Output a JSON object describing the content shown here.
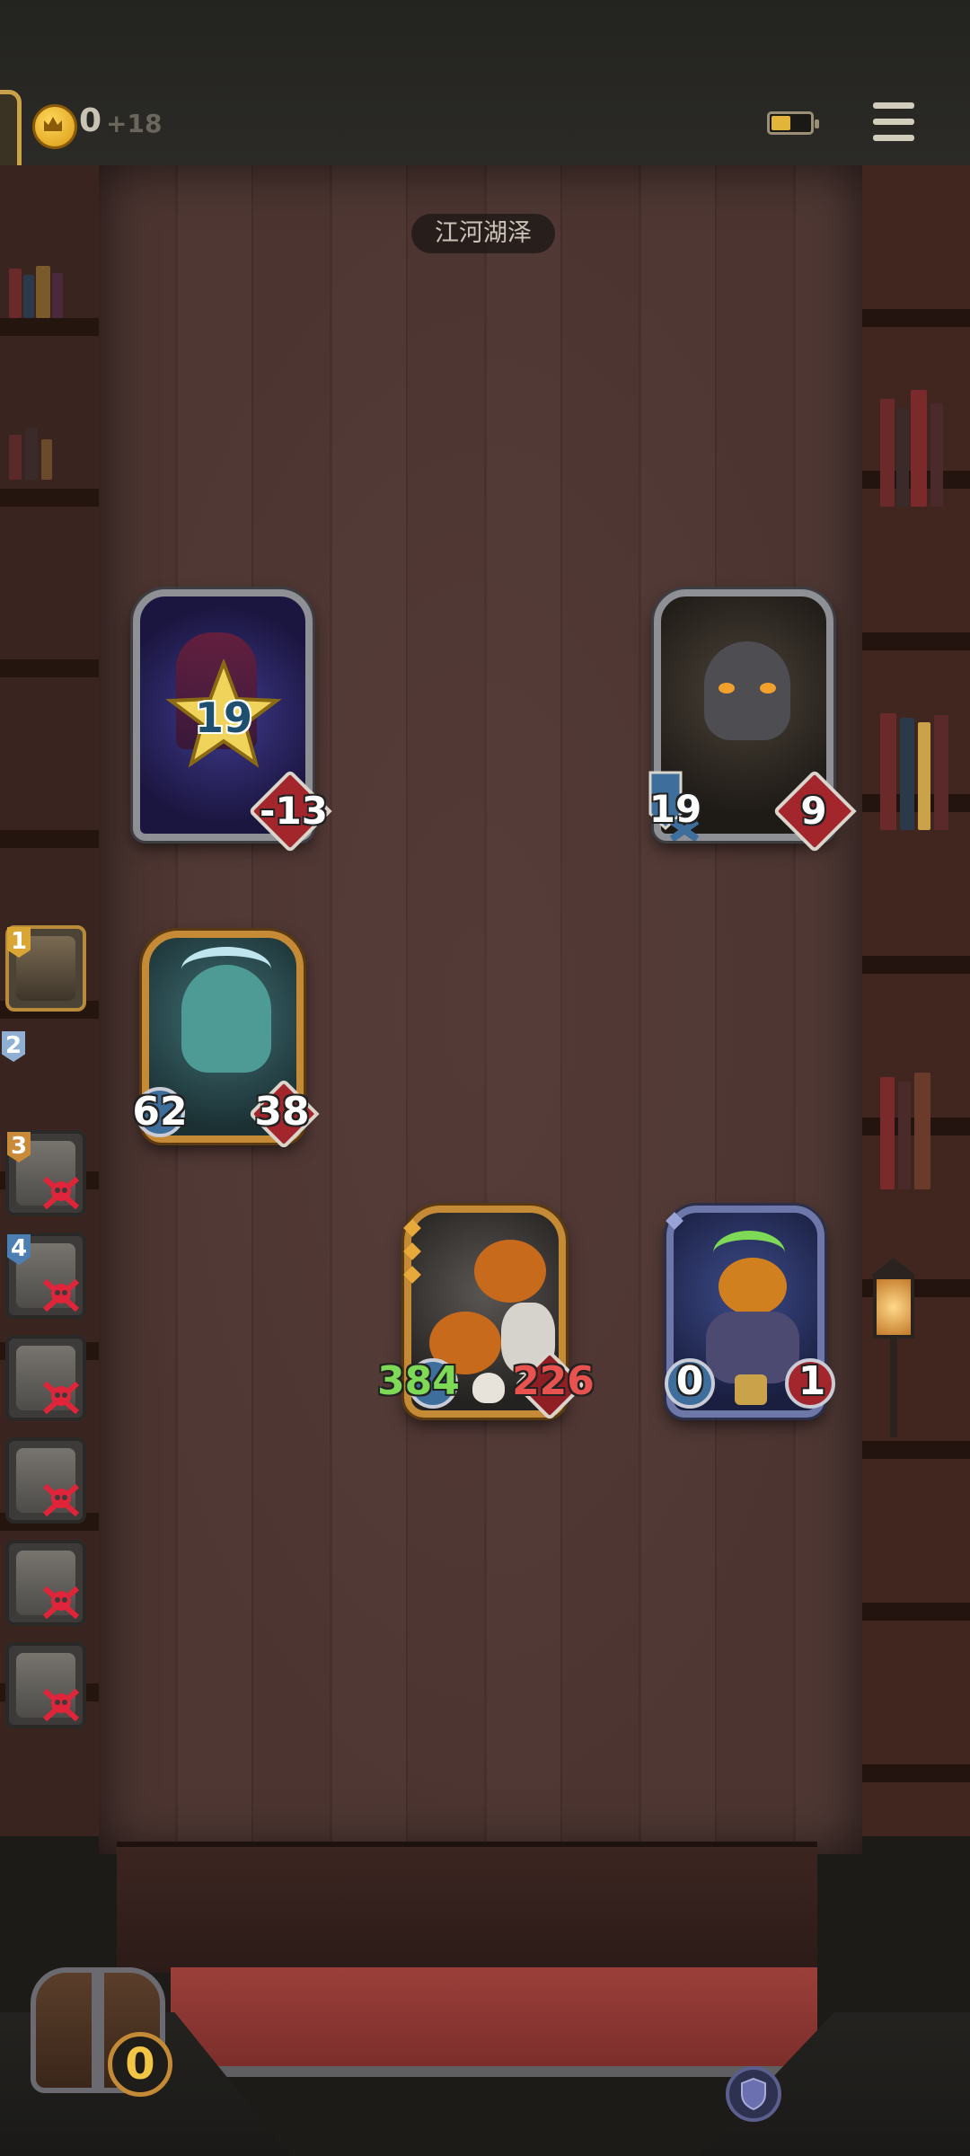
{
  "header": {
    "gold_amount": "0",
    "gold_delta": "+18",
    "battery_level_fraction": 0.5
  },
  "area_label": "江河湖泽",
  "enemy_row": [
    {
      "name": "star-ward",
      "star_value": "19",
      "health": "-13"
    },
    {
      "name": "gray-cat",
      "attack": "19",
      "health": "9"
    }
  ],
  "player_units": [
    {
      "name": "ghost-skeleton",
      "attack": "62",
      "health": "38"
    },
    {
      "name": "pumpkin-horde",
      "attack": "384",
      "health": "226"
    },
    {
      "name": "pumpkin-golem",
      "attack": "0",
      "health": "1"
    }
  ],
  "queue": [
    {
      "badge": "1",
      "defeated": false
    },
    {
      "badge": "2",
      "defeated": false
    },
    {
      "badge": "3",
      "defeated": true
    },
    {
      "badge": "4",
      "defeated": true
    },
    {
      "badge": "",
      "defeated": true
    },
    {
      "badge": "",
      "defeated": true
    },
    {
      "badge": "",
      "defeated": true
    },
    {
      "badge": "",
      "defeated": true
    }
  ],
  "footer": {
    "gold_counter": "0"
  },
  "colors": {
    "gold_accent": "#c48a35",
    "health_red": "#a3262c",
    "attack_blue": "#3d6e9c",
    "poison_green": "#7ed957"
  }
}
